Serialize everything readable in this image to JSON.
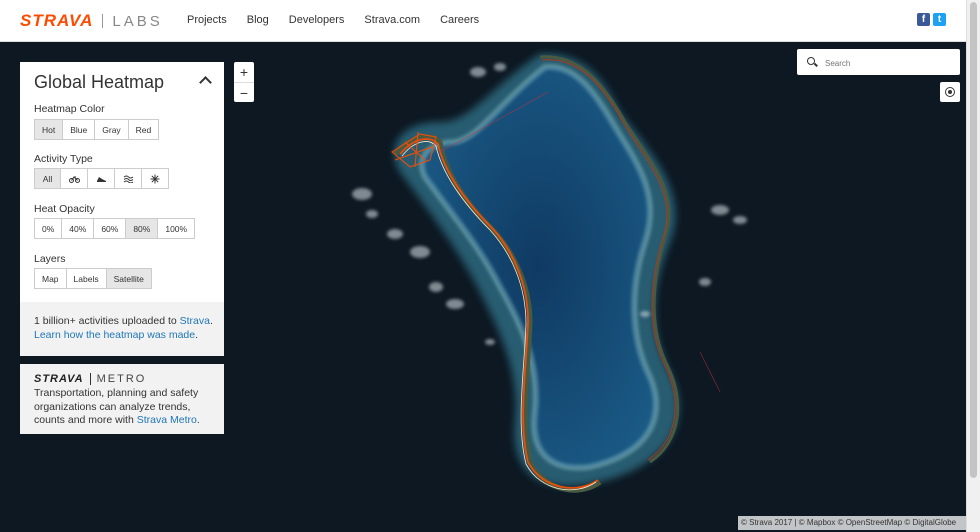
{
  "header": {
    "brand": "STRAVA",
    "sub_brand": "LABS",
    "nav": [
      "Projects",
      "Blog",
      "Developers",
      "Strava.com",
      "Careers"
    ],
    "social": [
      {
        "icon": "facebook-icon",
        "glyph": "f",
        "color": "#3b5998"
      },
      {
        "icon": "twitter-icon",
        "glyph": "t",
        "color": "#1da1f2"
      }
    ]
  },
  "panel": {
    "title": "Global Heatmap",
    "heatmap_color": {
      "label": "Heatmap Color",
      "options": [
        "Hot",
        "Blue",
        "Gray",
        "Red"
      ],
      "selected": "Hot"
    },
    "activity_type": {
      "label": "Activity Type",
      "options": [
        {
          "label": "All",
          "icon": null
        },
        {
          "label": "",
          "icon": "bike-icon"
        },
        {
          "label": "",
          "icon": "run-icon"
        },
        {
          "label": "",
          "icon": "water-icon"
        },
        {
          "label": "",
          "icon": "winter-icon"
        }
      ],
      "selected": "All"
    },
    "heat_opacity": {
      "label": "Heat Opacity",
      "options": [
        "0%",
        "40%",
        "60%",
        "80%",
        "100%"
      ],
      "selected": "80%"
    },
    "layers": {
      "label": "Layers",
      "options": [
        "Map",
        "Labels",
        "Satellite"
      ],
      "selected": "Satellite"
    },
    "footer": {
      "text1": "1 billion+ activities uploaded to ",
      "link1": "Strava",
      "text2": ".",
      "link2": "Learn how the heatmap was made",
      "text3": "."
    }
  },
  "metro": {
    "brand": "STRAVA",
    "product": "METRO",
    "text": "Transportation, planning and safety organizations can analyze trends, counts and more with ",
    "link": "Strava Metro",
    "end": "."
  },
  "map": {
    "zoom_in": "+",
    "zoom_out": "−",
    "search_placeholder": "Search",
    "attribution": "© Strava 2017 | © Mapbox © OpenStreetMap © DigitalGlobe",
    "colors": {
      "ocean": "#0e1a24",
      "lagoon": "#12466e",
      "reef": "#6fa3b0",
      "land": "#3a4a3c",
      "heat": "#fc4c02"
    }
  }
}
